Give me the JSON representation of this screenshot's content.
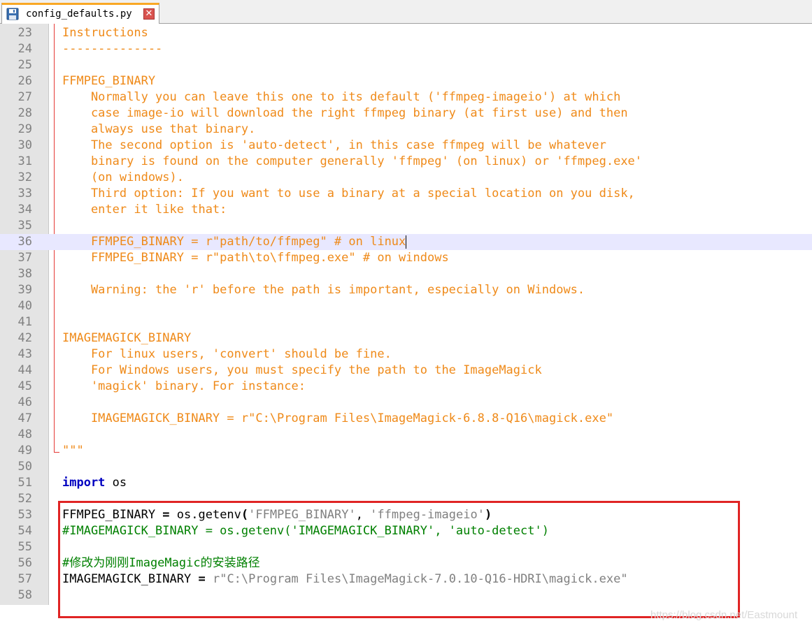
{
  "tab": {
    "file_name": "config_defaults.py",
    "close_symbol": "✕",
    "icon": "save-disk-icon"
  },
  "colors": {
    "docstring": "#ef8a19",
    "keyword": "#0000c0",
    "string": "#808080",
    "comment": "#008000",
    "highlight_box": "#e02424",
    "current_line": "#e8e8ff"
  },
  "editor": {
    "current_line": 36,
    "lines": [
      {
        "n": "23",
        "segments": [
          {
            "t": "Instructions",
            "c": "doc"
          }
        ]
      },
      {
        "n": "24",
        "segments": [
          {
            "t": "--------------",
            "c": "doc"
          }
        ]
      },
      {
        "n": "25",
        "segments": []
      },
      {
        "n": "26",
        "segments": [
          {
            "t": "FFMPEG_BINARY",
            "c": "doc"
          }
        ]
      },
      {
        "n": "27",
        "segments": [
          {
            "t": "    Normally you can leave this one to its default ('ffmpeg-imageio') at which",
            "c": "doc"
          }
        ]
      },
      {
        "n": "28",
        "segments": [
          {
            "t": "    case image-io will download the right ffmpeg binary (at first use) and then",
            "c": "doc"
          }
        ]
      },
      {
        "n": "29",
        "segments": [
          {
            "t": "    always use that binary.",
            "c": "doc"
          }
        ]
      },
      {
        "n": "30",
        "segments": [
          {
            "t": "    The second option is 'auto-detect', in this case ffmpeg will be whatever",
            "c": "doc"
          }
        ]
      },
      {
        "n": "31",
        "segments": [
          {
            "t": "    binary is found on the computer generally 'ffmpeg' (on linux) or 'ffmpeg.exe'",
            "c": "doc"
          }
        ]
      },
      {
        "n": "32",
        "segments": [
          {
            "t": "    (on windows).",
            "c": "doc"
          }
        ]
      },
      {
        "n": "33",
        "segments": [
          {
            "t": "    Third option: If you want to use a binary at a special location on you disk,",
            "c": "doc"
          }
        ]
      },
      {
        "n": "34",
        "segments": [
          {
            "t": "    enter it like that:",
            "c": "doc"
          }
        ]
      },
      {
        "n": "35",
        "segments": []
      },
      {
        "n": "36",
        "segments": [
          {
            "t": "    FFMPEG_BINARY = r\"path/to/ffmpeg\" # on linux",
            "c": "doc"
          }
        ]
      },
      {
        "n": "37",
        "segments": [
          {
            "t": "    FFMPEG_BINARY = r\"path\\to\\ffmpeg.exe\" # on windows",
            "c": "doc"
          }
        ]
      },
      {
        "n": "38",
        "segments": []
      },
      {
        "n": "39",
        "segments": [
          {
            "t": "    Warning: the 'r' before the path is important, especially on Windows.",
            "c": "doc"
          }
        ]
      },
      {
        "n": "40",
        "segments": []
      },
      {
        "n": "41",
        "segments": []
      },
      {
        "n": "42",
        "segments": [
          {
            "t": "IMAGEMAGICK_BINARY",
            "c": "doc"
          }
        ]
      },
      {
        "n": "43",
        "segments": [
          {
            "t": "    For linux users, 'convert' should be fine.",
            "c": "doc"
          }
        ]
      },
      {
        "n": "44",
        "segments": [
          {
            "t": "    For Windows users, you must specify the path to the ImageMagick",
            "c": "doc"
          }
        ]
      },
      {
        "n": "45",
        "segments": [
          {
            "t": "    'magick' binary. For instance:",
            "c": "doc"
          }
        ]
      },
      {
        "n": "46",
        "segments": []
      },
      {
        "n": "47",
        "segments": [
          {
            "t": "    IMAGEMAGICK_BINARY = r\"C:\\Program Files\\ImageMagick-6.8.8-Q16\\magick.exe\"",
            "c": "doc"
          }
        ]
      },
      {
        "n": "48",
        "segments": []
      },
      {
        "n": "49",
        "segments": [
          {
            "t": "\"\"\"",
            "c": "doc"
          }
        ]
      },
      {
        "n": "50",
        "segments": []
      },
      {
        "n": "51",
        "segments": [
          {
            "t": "import",
            "c": "kw"
          },
          {
            "t": " os",
            "c": "plain"
          }
        ]
      },
      {
        "n": "52",
        "segments": []
      },
      {
        "n": "53",
        "segments": [
          {
            "t": "FFMPEG_BINARY ",
            "c": "plain"
          },
          {
            "t": "=",
            "c": "op"
          },
          {
            "t": " os.getenv",
            "c": "plain"
          },
          {
            "t": "(",
            "c": "op"
          },
          {
            "t": "'FFMPEG_BINARY'",
            "c": "str"
          },
          {
            "t": ", ",
            "c": "plain"
          },
          {
            "t": "'ffmpeg-imageio'",
            "c": "str"
          },
          {
            "t": ")",
            "c": "op"
          }
        ]
      },
      {
        "n": "54",
        "segments": [
          {
            "t": "#IMAGEMAGICK_BINARY = os.getenv('IMAGEMAGICK_BINARY', 'auto-detect')",
            "c": "comment"
          }
        ]
      },
      {
        "n": "55",
        "segments": []
      },
      {
        "n": "56",
        "segments": [
          {
            "t": "#修改为刚刚ImageMagic的安装路径",
            "c": "comment"
          }
        ]
      },
      {
        "n": "57",
        "segments": [
          {
            "t": "IMAGEMAGICK_BINARY ",
            "c": "plain"
          },
          {
            "t": "=",
            "c": "op"
          },
          {
            "t": " ",
            "c": "plain"
          },
          {
            "t": "r\"C:\\Program Files\\ImageMagick-7.0.10-Q16-HDRI\\magick.exe\"",
            "c": "str"
          }
        ]
      },
      {
        "n": "58",
        "segments": []
      }
    ]
  },
  "watermark": "https://blog.csdn.net/Eastmount"
}
